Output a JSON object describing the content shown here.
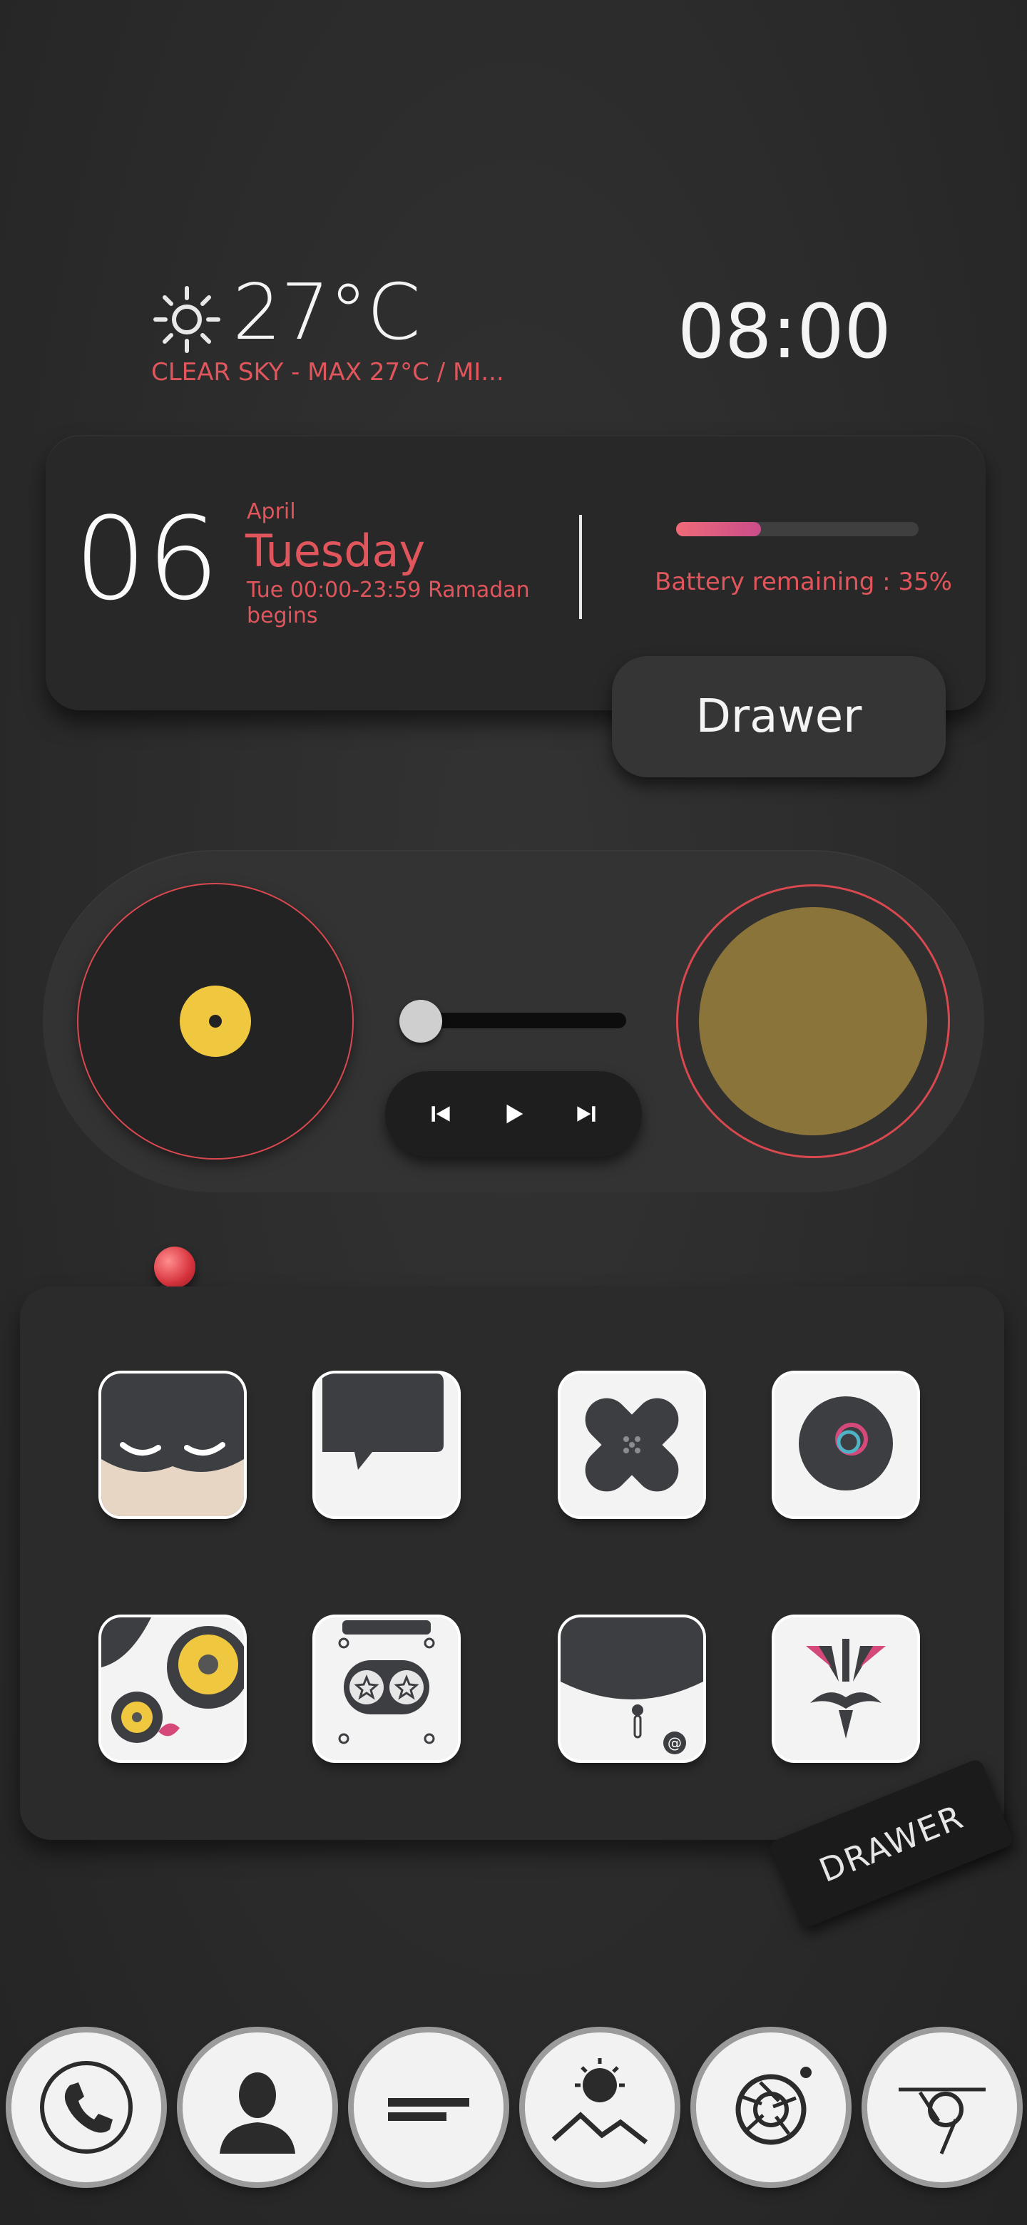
{
  "weather": {
    "temperature": "27°C",
    "description": "CLEAR SKY - MAX 27°C / MI..."
  },
  "clock": {
    "time": "08:00"
  },
  "date_card": {
    "day": "06",
    "month": "April",
    "weekday": "Tuesday",
    "event": "Tue 00:00-23:59 Ramadan begins"
  },
  "battery": {
    "label": "Battery remaining : 35%",
    "level_percent": 35,
    "fill_colors": [
      "#f06a78",
      "#c94d8a"
    ]
  },
  "drawer_button": {
    "label": "Drawer"
  },
  "music": {
    "progress_percent": 0,
    "accent_color": "#d9484f",
    "controls": [
      "previous-icon",
      "play-icon",
      "next-icon"
    ]
  },
  "apps": [
    {
      "icon": "batman-icon"
    },
    {
      "icon": "chat-bubble-icon"
    },
    {
      "icon": "bandage-icon"
    },
    {
      "icon": "camera-lens-icon"
    },
    {
      "icon": "monster-face-icon"
    },
    {
      "icon": "cassette-icon"
    },
    {
      "icon": "zipper-pocket-icon"
    },
    {
      "icon": "mustache-mask-icon"
    }
  ],
  "drawer_tag": {
    "label": "DRAWER"
  },
  "dock": [
    {
      "icon": "phone-icon"
    },
    {
      "icon": "contact-icon"
    },
    {
      "icon": "message-icon"
    },
    {
      "icon": "gallery-icon"
    },
    {
      "icon": "camera-icon"
    },
    {
      "icon": "browser-icon"
    }
  ],
  "colors": {
    "accent": "#e0565c",
    "background": "#2b2b2b",
    "tile": "#f3f3f3"
  }
}
